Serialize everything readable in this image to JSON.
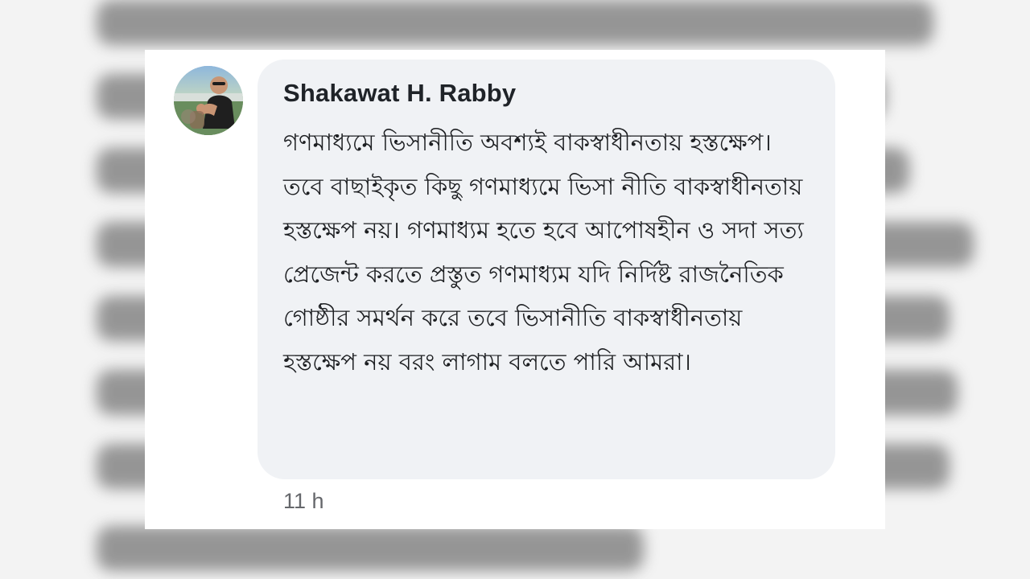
{
  "comment": {
    "author": "Shakawat H. Rabby",
    "text": "গণমাধ্যমে ভিসানীতি অবশ্যই বাকস্বাধীনতায় হস্তক্ষেপ। তবে বাছাইকৃত কিছু গণমাধ্যমে ভিসা নীতি বাকস্বাধীনতায় হস্তক্ষেপ নয়। গণমাধ্যম হতে হবে আপোষহীন ও সদা সত্য প্রেজেন্ট করতে প্রস্তুত গণমাধ্যম যদি নির্দিষ্ট রাজনৈতিক গোষ্ঠীর সমর্থন করে তবে ভিসানীতি বাকস্বাধীনতায় হস্তক্ষেপ নয় বরং লাগাম বলতে পারি আমরা।",
    "timestamp": "11 h"
  },
  "colors": {
    "bubble_background": "#f0f2f5",
    "author_text": "#1f2328",
    "body_text": "#1c1e21",
    "timestamp_text": "#65676b"
  },
  "icons": {
    "avatar": "profile-photo"
  }
}
